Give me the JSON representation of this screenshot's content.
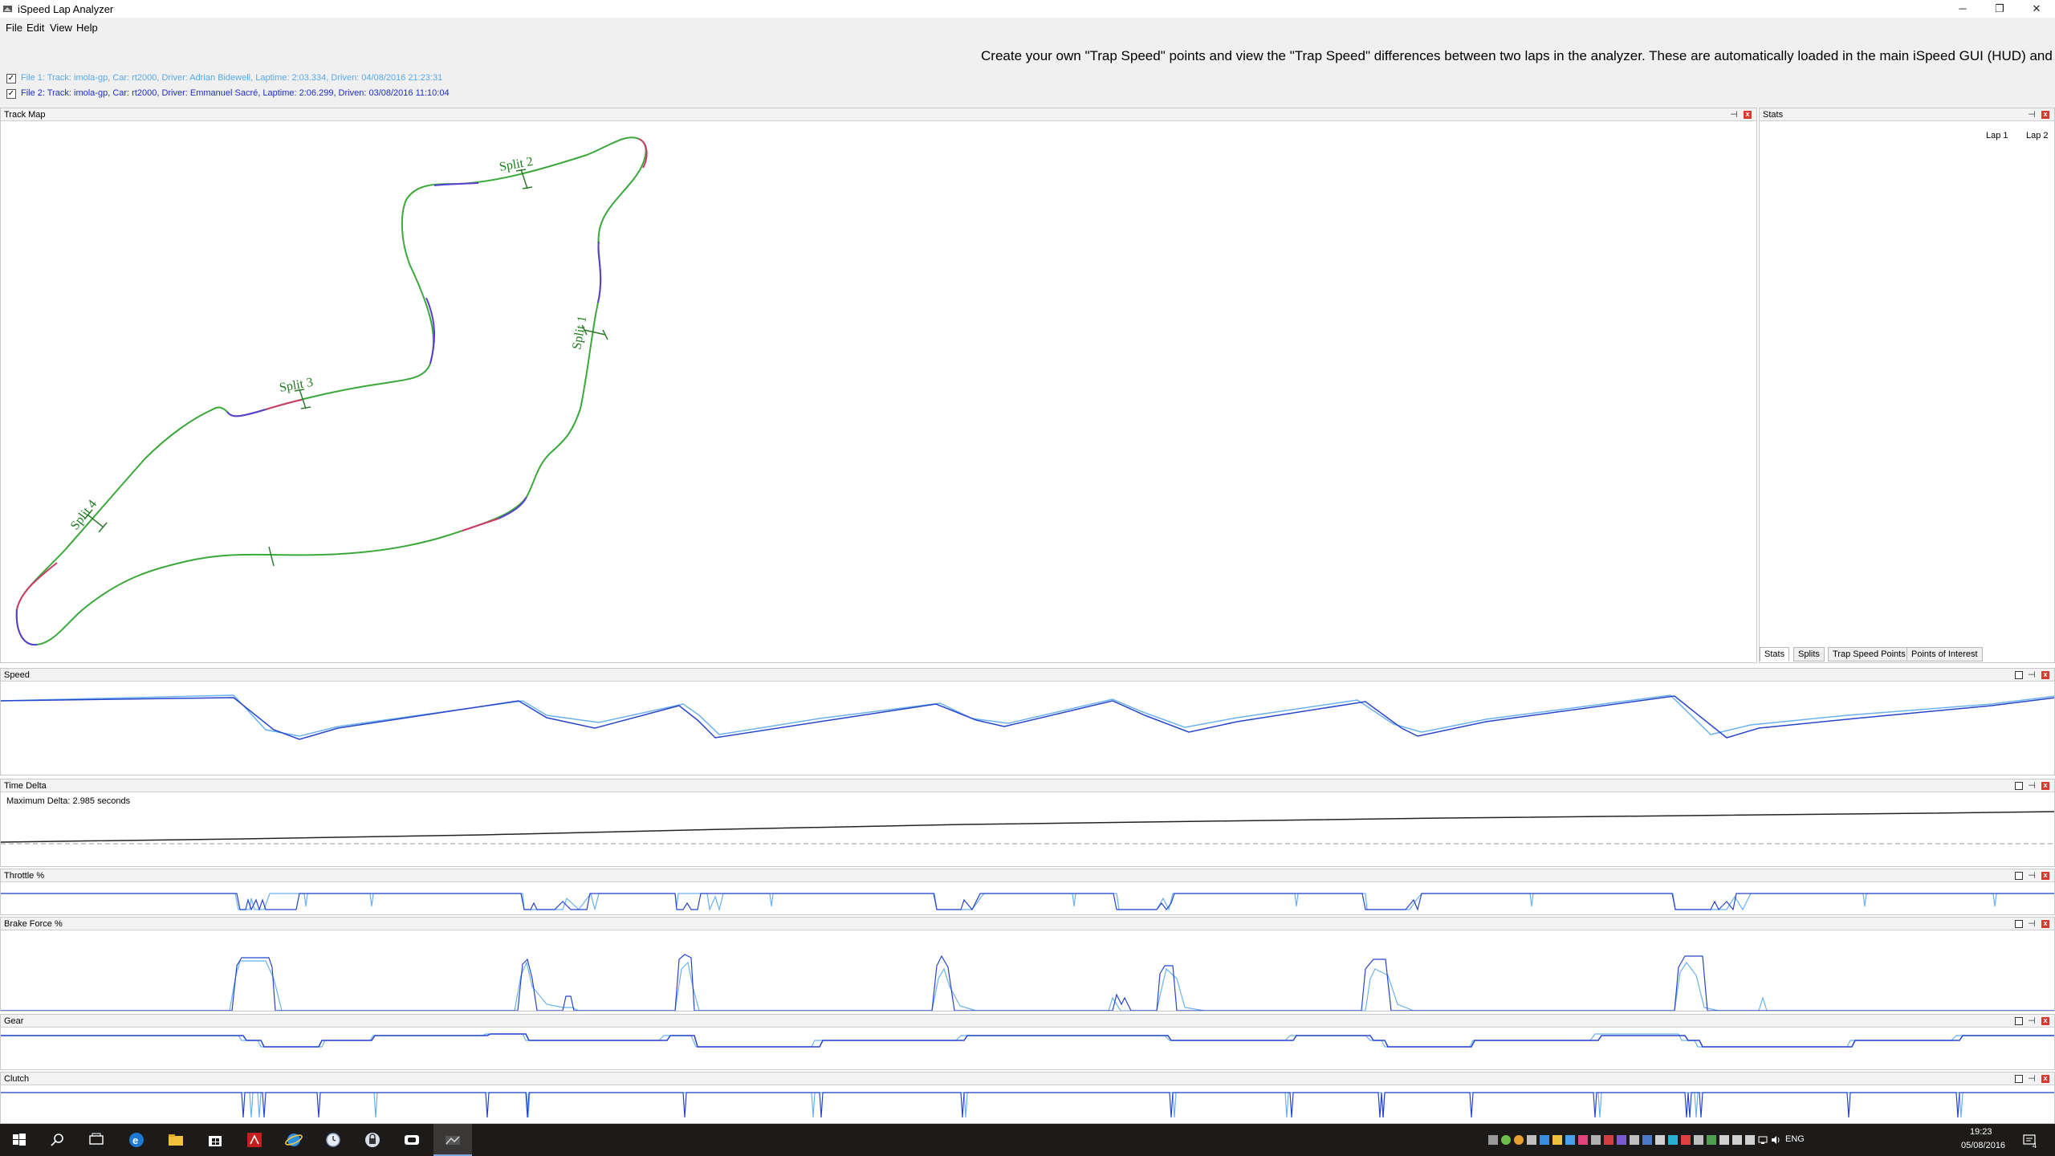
{
  "window": {
    "title": "iSpeed Lap Analyzer",
    "controls": {
      "minimize": "─",
      "restore": "❐",
      "close": "✕"
    }
  },
  "menu": [
    "File",
    "Edit",
    "View",
    "Help"
  ],
  "banner": "Create your own \"Trap Speed\" points and view the \"Trap Speed\" differences between two laps in the analyzer.  These are automatically loaded in the main iSpeed GUI (HUD) and trap speed",
  "files": [
    {
      "checked": true,
      "label": "File 1: Track: imola-gp, Car: rt2000, Driver: Adrian Bidewell, Laptime: 2:03.334, Driven: 04/08/2016 21:23:31",
      "color": "#5aa9ea"
    },
    {
      "checked": true,
      "label": "File 2: Track: imola-gp, Car: rt2000, Driver: Emmanuel Sacré, Laptime: 2:06.299, Driven: 03/08/2016 11:10:04",
      "color": "#1c2fc4"
    }
  ],
  "colors": {
    "lap1": "#6ab2ee",
    "lap2": "#2844cc",
    "track_green": "#3aa83a",
    "split_text": "#1f7a1f",
    "close_red": "#d83a2e"
  },
  "track_map": {
    "title": "Track Map",
    "splits": [
      "Split 1",
      "Split 2",
      "Split 3",
      "Split 4"
    ]
  },
  "stats": {
    "title": "Stats",
    "columns": [
      "Lap 1",
      "Lap 2"
    ],
    "tabs": [
      "Stats",
      "Splits",
      "Trap Speed Points",
      "Points of Interest"
    ],
    "active_tab": "Stats"
  },
  "charts": {
    "speed": {
      "title": "Speed"
    },
    "delta": {
      "title": "Time Delta",
      "label": "Maximum Delta: 2.985 seconds"
    },
    "throttle": {
      "title": "Throttle %"
    },
    "brake": {
      "title": "Brake Force %"
    },
    "gear": {
      "title": "Gear"
    },
    "clutch": {
      "title": "Clutch"
    }
  },
  "taskbar": {
    "icons": [
      "windows-start-icon",
      "search-icon",
      "task-view-icon",
      "edge-icon",
      "file-explorer-icon",
      "store-icon",
      "acrobat-icon",
      "internet-explorer-icon",
      "clock-app-icon",
      "security-app-icon",
      "media-app-icon",
      "ispeed-app-icon"
    ],
    "language": "ENG",
    "time": "19:23",
    "date": "05/08/2016",
    "notification_count": "4"
  }
}
